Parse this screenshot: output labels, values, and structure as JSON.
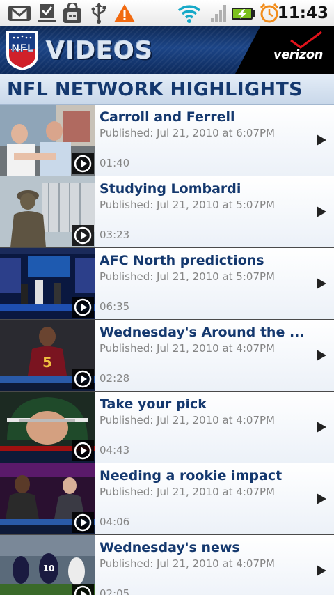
{
  "status_bar": {
    "time": "11:43",
    "icons": [
      "gmail-icon",
      "download-done-icon",
      "market-bag-icon",
      "usb-icon",
      "warning-icon",
      "wifi-icon",
      "signal-icon",
      "battery-charging-icon",
      "alarm-clock-icon"
    ]
  },
  "header": {
    "logo_text": "NFL",
    "title": "VIDEOS",
    "sponsor": "verizon"
  },
  "section": {
    "title": "NFL NETWORK HIGHLIGHTS"
  },
  "videos": [
    {
      "title": "Carroll and Ferrell",
      "published": "Published: Jul 21, 2010 at  6:07PM",
      "duration": "01:40"
    },
    {
      "title": "Studying Lombardi",
      "published": "Published: Jul 21, 2010 at  5:07PM",
      "duration": "03:23"
    },
    {
      "title": "AFC North predictions",
      "published": "Published: Jul 21, 2010 at  5:07PM",
      "duration": "06:35"
    },
    {
      "title": "Wednesday's Around the ...",
      "published": "Published: Jul 21, 2010 at  4:07PM",
      "duration": "02:28"
    },
    {
      "title": "Take your pick",
      "published": "Published: Jul 21, 2010 at  4:07PM",
      "duration": "04:43"
    },
    {
      "title": "Needing a rookie impact",
      "published": "Published: Jul 21, 2010 at  4:07PM",
      "duration": "04:06"
    },
    {
      "title": "Wednesday's news",
      "published": "Published: Jul 21, 2010 at  4:07PM",
      "duration": "02:05"
    }
  ],
  "colors": {
    "title_blue": "#14386e",
    "meta_gray": "#858585",
    "header_navy": "#1c4587",
    "warning_orange": "#f26a10",
    "wifi_teal": "#17a9c8",
    "battery_green": "#7cc11e"
  }
}
